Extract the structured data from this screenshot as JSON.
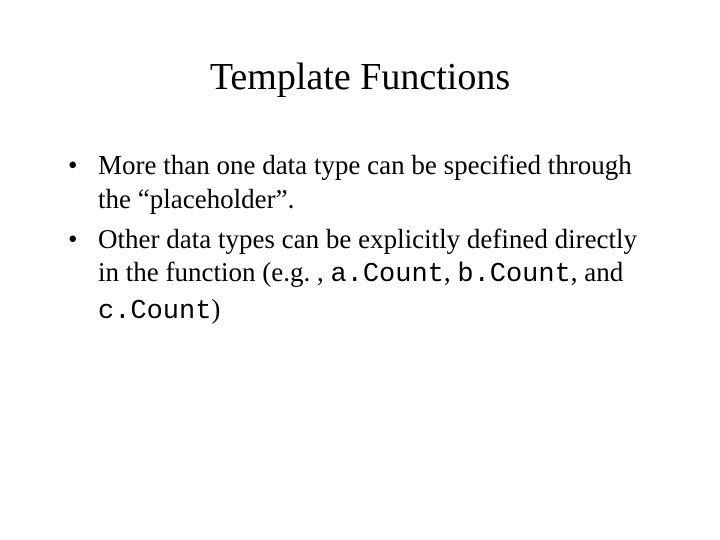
{
  "title": "Template Functions",
  "bullets": [
    {
      "pre": "More than one data type can be specified through the “placeholder”."
    },
    {
      "pre": "Other data types can be explicitly defined directly in the function (e.g. , ",
      "code1": "a.Count",
      "mid1": ", ",
      "code2": "b.Count",
      "mid2": ", and ",
      "code3": "c.Count",
      "post": ")"
    }
  ]
}
